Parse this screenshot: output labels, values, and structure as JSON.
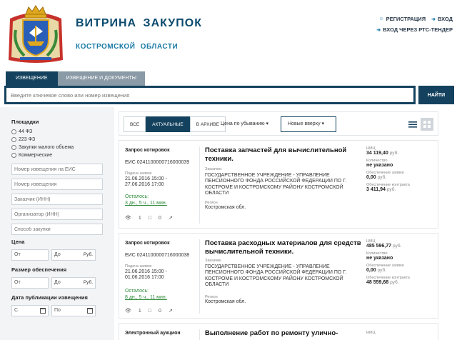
{
  "header": {
    "title": "ВИТРИНА  ЗАКУПОК",
    "subtitle": "КОСТРОМСКОЙ  ОБЛАСТИ",
    "register_label": "РЕГИСТРАЦИЯ",
    "login_label": "ВХОД",
    "login_rts_label": "ВХОД ЧЕРЕЗ РТС-ТЕНДЕР"
  },
  "search": {
    "tabs": [
      "ИЗВЕЩЕНИЕ",
      "ИЗВЕЩЕНИЕ И ДОКУМЕНТЫ"
    ],
    "placeholder": "Введите ключевое слово или номер извещения",
    "button_label": "НАЙТИ"
  },
  "filters": {
    "platforms_title": "Площадки",
    "platform_options": [
      "44 ФЗ",
      "223 ФЗ",
      "Закупки малого объема",
      "Коммерческие"
    ],
    "eis_number_placeholder": "Номер извещения на ЕИС",
    "notice_number_placeholder": "Номер извещения",
    "customer_placeholder": "Заказчик (ИНН)",
    "organizer_placeholder": "Организатор (ИНН)",
    "method_placeholder": "Способ закупки",
    "price_title": "Цена",
    "from_label": "От",
    "to_label": "До",
    "currency_suffix": "Руб.",
    "security_title": "Размер обеспечения",
    "pub_date_title": "Дата публикации извещения",
    "date_from_label": "С",
    "date_to_label": "По"
  },
  "toolbar": {
    "status_tabs": [
      "ВСЕ",
      "АКТУАЛЬНЫЕ",
      "В АРХИВЕ"
    ],
    "sort_price": "Цена по убыванию ▾",
    "sort_date": "Новые вверху ▾"
  },
  "cards": [
    {
      "type": "Запрос котировок",
      "eis": "ЕИС 0241100000716000039",
      "dates_label": "Подача заявок",
      "date_start": "21.06.2016 15:00 -",
      "date_end": "27.06.2016 17:00",
      "remaining_label": "Осталось:",
      "remaining": "3 дн., 5 ч., 11 мин.",
      "views": "1",
      "comments": "0",
      "title": "Поставка запчастей для вычислительной техники.",
      "customer_label": "Заказчик:",
      "customer": "ГОСУДАРСТВЕННОЕ УЧРЕЖДЕНИЕ - УПРАВЛЕНИЕ ПЕНСИОННОГО ФОНДА РОССИЙСКОЙ ФЕДЕРАЦИИ ПО Г. КОСТРОМЕ И КОСТРОМСКОМУ РАЙОНУ КОСТРОМСКОЙ ОБЛАСТИ",
      "region_label": "Регион",
      "region": "Костромская обл.",
      "nmc_label": "НМЦ",
      "nmc": "34 119,40",
      "currency": "руб.",
      "qty_label": "Количество",
      "qty": "не указано",
      "app_security_label": "Обеспечение заявки",
      "app_security": "0,00",
      "contract_security_label": "Обеспечение контракта",
      "contract_security": "3 411,94"
    },
    {
      "type": "Запрос котировок",
      "eis": "ЕИС 0241100000716000038",
      "dates_label": "Подача заявок",
      "date_start": "21.06.2016 15:00 -",
      "date_end": "01.06.2016 17:00",
      "remaining_label": "Осталось:",
      "remaining": "8 дн., 5 ч., 11 мин.",
      "views": "1",
      "comments": "0",
      "title": "Поставка расходных материалов для средств вычислительной техники.",
      "customer_label": "Заказчик",
      "customer": "ГОСУДАРСТВЕННОЕ УЧРЕЖДЕНИЕ - УПРАВЛЕНИЕ ПЕНСИОННОГО ФОНДА РОССИЙСКОЙ ФЕДЕРАЦИИ ПО Г. КОСТРОМЕ И КОСТРОМСКОМУ РАЙОНУ КОСТРОМСКОЙ ОБЛАСТИ",
      "region_label": "Регион",
      "region": "Костромская обл.",
      "nmc_label": "НМЦ",
      "nmc": "485 596,77",
      "currency": "руб.",
      "qty_label": "Количество",
      "qty": "не указано",
      "app_security_label": "Обеспечение заявки",
      "app_security": "0,00",
      "contract_security_label": "Обеспечение контракта",
      "contract_security": "48 559,68"
    },
    {
      "type": "Электронный аукцион",
      "title": "Выполнение работ по ремонту улично-",
      "nmc_label": "НМЦ"
    }
  ]
}
